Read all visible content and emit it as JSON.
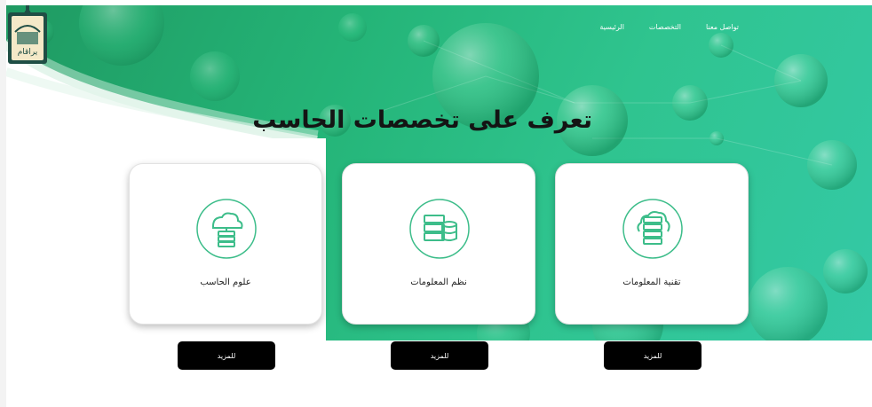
{
  "nav": {
    "items": [
      {
        "label": "الرئيسية"
      },
      {
        "label": "التخصصات"
      },
      {
        "label": "تواصل معنا"
      }
    ]
  },
  "logo": {
    "text": "يراقام"
  },
  "hero": {
    "title": "تعرف على تخصصات الحاسب"
  },
  "cards": [
    {
      "label": "علوم الحاسب",
      "icon": "cloud-server-icon"
    },
    {
      "label": "نظم المعلومات",
      "icon": "database-server-icon"
    },
    {
      "label": "تقنية المعلومات",
      "icon": "server-rack-icon"
    }
  ],
  "buttons": [
    {
      "label": "للمزيد"
    },
    {
      "label": "للمزيد"
    },
    {
      "label": "للمزيد"
    }
  ],
  "colors": {
    "hero_green": "#24b477",
    "accent_green": "#3dbd8a",
    "button_black": "#000000"
  }
}
